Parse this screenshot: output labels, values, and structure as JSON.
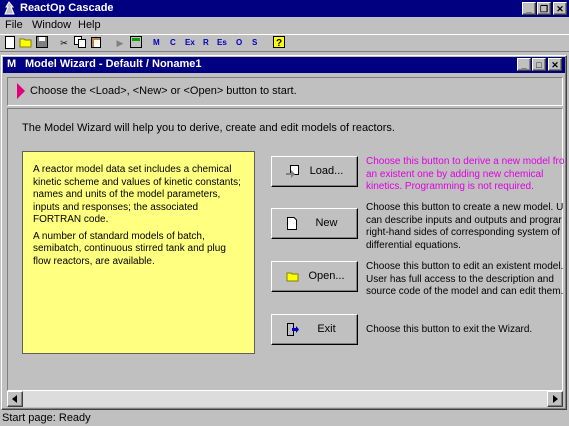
{
  "app": {
    "title": "ReactOp Cascade"
  },
  "menu": [
    "File",
    "Window",
    "Help"
  ],
  "toolbar": {
    "letters": [
      "M",
      "C",
      "Ex",
      "R",
      "Es",
      "O",
      "S"
    ]
  },
  "child": {
    "title": "Model Wizard - Default / Noname1",
    "icon_letter": "M"
  },
  "hint": "Choose the <Load>, <New> or <Open> button to start.",
  "intro": "The Model Wizard will help you to derive, create and edit models of reactors.",
  "info": {
    "p1": "A reactor model data set includes a chemical kinetic scheme and values of kinetic constants; names and units of the model parameters, inputs and responses; the associated FORTRAN code.",
    "p2": "A number of standard models of batch, semibatch, continuous stirred tank and plug flow reactors, are available."
  },
  "buttons": {
    "load": {
      "label": "Load...",
      "desc": [
        "Choose this button to derive a new model fro",
        "an existent one by adding new chemical",
        "kinetics. Programming is not required."
      ]
    },
    "new": {
      "label": "New",
      "desc": [
        "Choose this button to create a new model. U",
        "can describe inputs and outputs and prograr",
        "right-hand sides of corresponding system of",
        "differential equations."
      ]
    },
    "open": {
      "label": "Open...",
      "desc": [
        "Choose this button to edit an existent model.",
        "User has full access to the description and",
        "source code of the model and can edit them."
      ]
    },
    "exit": {
      "label": "Exit",
      "desc": [
        "Choose this button to exit the Wizard."
      ]
    }
  },
  "status": "Start page:  Ready",
  "colors": {
    "titlebar": "#000080",
    "panel": "#ffff80",
    "load_desc": "#e000e0",
    "hint_arrow": "#e0007a"
  }
}
